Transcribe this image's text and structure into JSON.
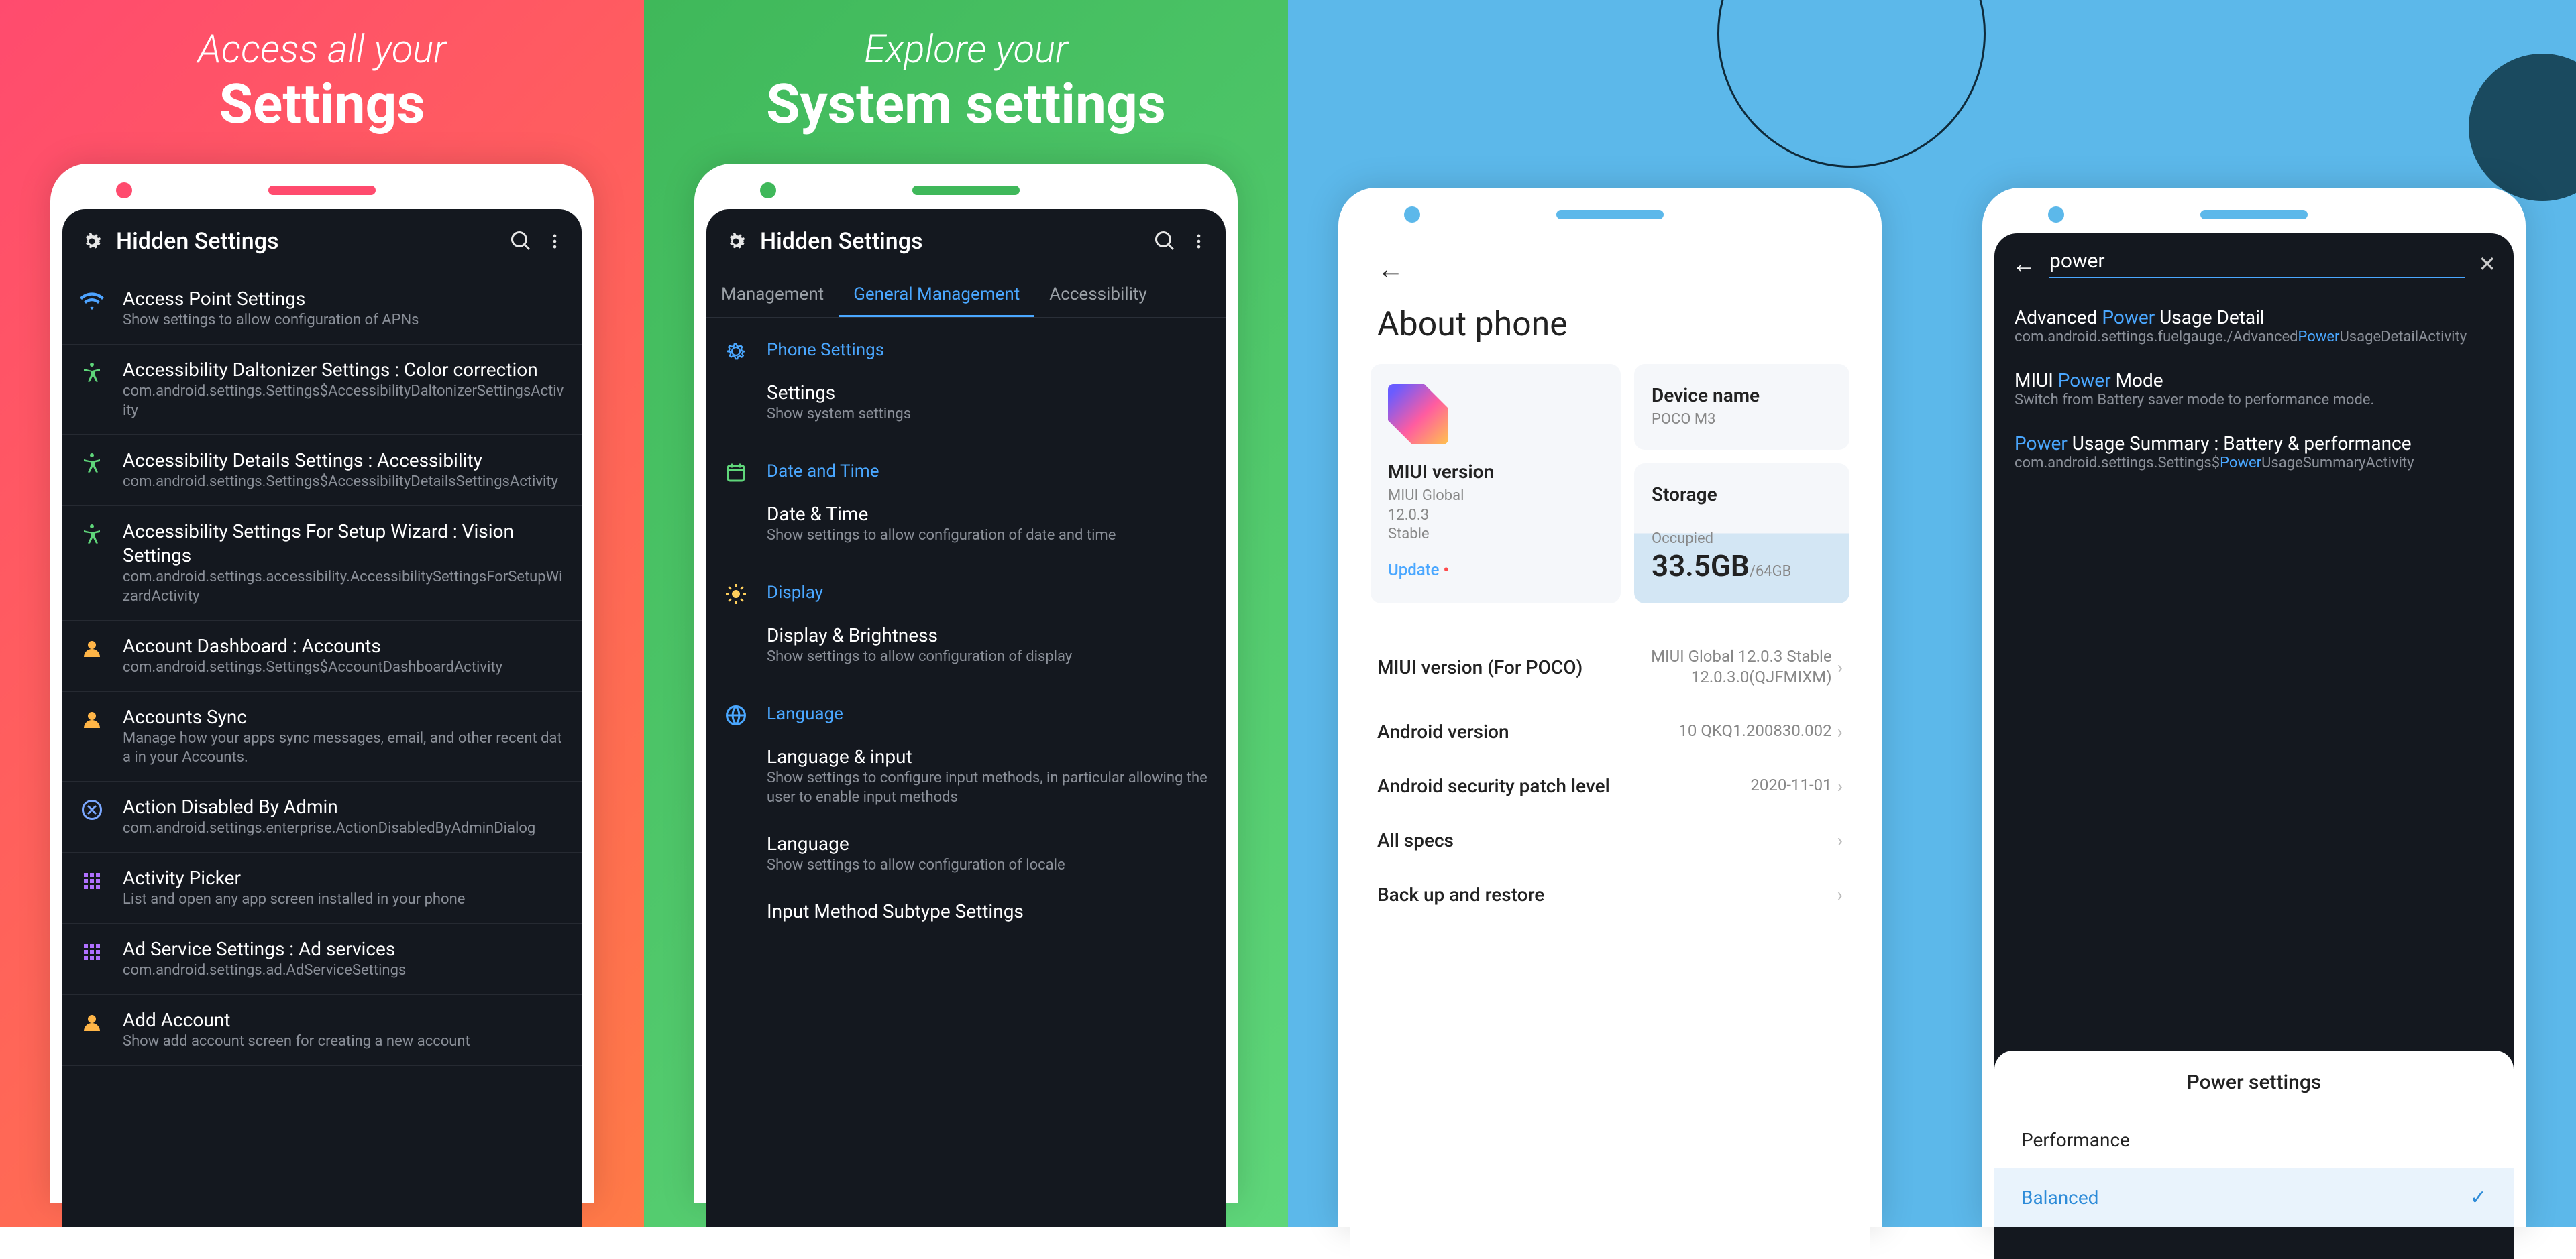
{
  "panel1": {
    "headline1": "Access all your",
    "headline2": "Settings",
    "app_title": "Hidden Settings",
    "items": [
      {
        "icon": "wifi",
        "title": "Access Point Settings",
        "sub": "Show settings to allow configuration of APNs"
      },
      {
        "icon": "a11y",
        "title": "Accessibility Daltonizer Settings : Color correction",
        "sub": "com.android.settings.Settings$AccessibilityDaltonizerSettingsActivity"
      },
      {
        "icon": "a11y",
        "title": "Accessibility Details Settings : Accessibility",
        "sub": "com.android.settings.Settings$AccessibilityDetailsSettingsActivity"
      },
      {
        "icon": "a11y",
        "title": "Accessibility Settings For Setup Wizard : Vision Settings",
        "sub": "com.android.settings.accessibility.AccessibilitySettingsForSetupWizardActivity"
      },
      {
        "icon": "account",
        "title": "Account Dashboard : Accounts",
        "sub": "com.android.settings.Settings$AccountDashboardActivity"
      },
      {
        "icon": "account",
        "title": "Accounts Sync",
        "sub": "Manage how your apps sync messages, email, and other recent data in your Accounts."
      },
      {
        "icon": "admin",
        "title": "Action Disabled By Admin",
        "sub": "com.android.settings.enterprise.ActionDisabledByAdminDialog"
      },
      {
        "icon": "apps",
        "title": "Activity Picker",
        "sub": "List and open any app screen installed in your phone"
      },
      {
        "icon": "apps",
        "title": "Ad Service Settings : Ad services",
        "sub": "com.android.settings.ad.AdServiceSettings"
      },
      {
        "icon": "account",
        "title": "Add Account",
        "sub": "Show add account screen for creating a new account"
      }
    ]
  },
  "panel2": {
    "headline1": "Explore your",
    "headline2": "System settings",
    "app_title": "Hidden Settings",
    "tabs": {
      "left": "Management",
      "center": "General Management",
      "right": "Accessibility"
    },
    "sections": [
      {
        "icon": "gear",
        "label": "Phone Settings",
        "items": [
          {
            "t": "Settings",
            "s": "Show system settings"
          }
        ]
      },
      {
        "icon": "calendar",
        "label": "Date and Time",
        "items": [
          {
            "t": "Date & Time",
            "s": "Show settings to allow configuration of date and time"
          }
        ]
      },
      {
        "icon": "display",
        "label": "Display",
        "items": [
          {
            "t": "Display & Brightness",
            "s": "Show settings to allow configuration of display"
          }
        ]
      },
      {
        "icon": "globe",
        "label": "Language",
        "items": [
          {
            "t": "Language & input",
            "s": "Show settings to configure input methods, in particular allowing the user to enable input methods"
          },
          {
            "t": "Language",
            "s": "Show settings to allow configuration of locale"
          },
          {
            "t": "Input Method Subtype Settings",
            "s": ""
          }
        ]
      }
    ]
  },
  "panel3": {
    "title": "About phone",
    "miui_card": {
      "label": "MIUI version",
      "sub": "MIUI Global\n12.0.3\nStable",
      "update": "Update"
    },
    "device_card": {
      "label": "Device name",
      "value": "POCO M3"
    },
    "storage_card": {
      "label": "Storage",
      "occupied_label": "Occupied",
      "value": "33.5GB",
      "total": "/64GB"
    },
    "rows": [
      {
        "k": "MIUI version (For POCO)",
        "v": "MIUI Global 12.0.3 Stable 12.0.3.0(QJFMIXM)"
      },
      {
        "k": "Android version",
        "v": "10 QKQ1.200830.002"
      },
      {
        "k": "Android security patch level",
        "v": "2020-11-01"
      },
      {
        "k": "All specs",
        "v": ""
      },
      {
        "k": "Back up and restore",
        "v": ""
      }
    ]
  },
  "panel4": {
    "search_query": "power",
    "results": [
      {
        "pre": "Advanced ",
        "hl": "Power",
        "post": " Usage Detail",
        "sub_pre": "com.android.settings.fuelgauge./Advanced",
        "sub_hl": "Power",
        "sub_post": "UsageDetailActivity"
      },
      {
        "pre": "MIUI ",
        "hl": "Power",
        "post": " Mode",
        "sub_pre": "Switch from Battery saver mode to performance mode.",
        "sub_hl": "",
        "sub_post": ""
      },
      {
        "pre": "",
        "hl": "Power",
        "post": " Usage Summary : Battery & performance",
        "sub_pre": "com.android.settings.Settings$",
        "sub_hl": "Power",
        "sub_post": "UsageSummaryActivity"
      }
    ],
    "sheet": {
      "title": "Power settings",
      "options": [
        {
          "label": "Performance",
          "selected": false
        },
        {
          "label": "Balanced",
          "selected": true
        }
      ]
    }
  }
}
